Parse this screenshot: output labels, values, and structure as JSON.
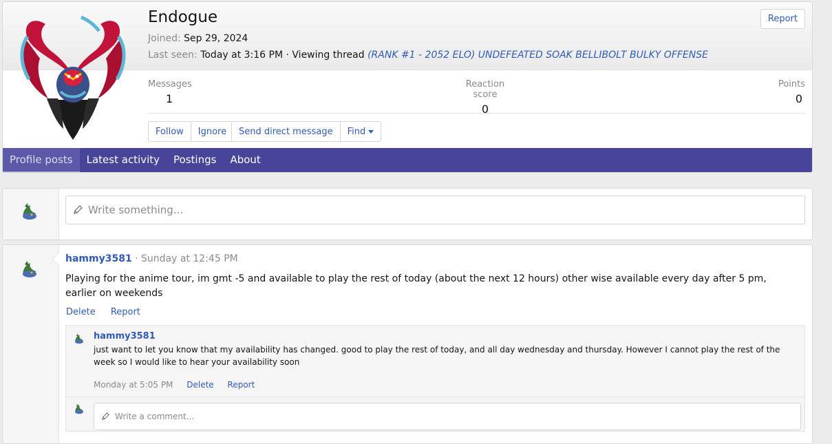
{
  "profile": {
    "username": "Endogue",
    "joined_label": "Joined:",
    "joined_value": "Sep 29, 2024",
    "last_seen_label": "Last seen:",
    "last_seen_value": "Today at 3:16 PM · Viewing thread",
    "thread_link": "(RANK #1 - 2052 ELO) UNDEFEATED SOAK BELLIBOLT BULKY OFFENSE",
    "report_label": "Report",
    "stats": {
      "messages_label": "Messages",
      "messages_value": "1",
      "reaction_label": "Reaction score",
      "reaction_value": "0",
      "points_label": "Points",
      "points_value": "0"
    },
    "buttons": {
      "follow": "Follow",
      "ignore": "Ignore",
      "send_dm": "Send direct message",
      "find": "Find"
    },
    "tabs": [
      "Profile posts",
      "Latest activity",
      "Postings",
      "About"
    ],
    "accent_color": "#47449a"
  },
  "compose": {
    "placeholder": "Write something..."
  },
  "post": {
    "author": "hammy3581",
    "time": "· Sunday at 12:45 PM",
    "body": "Playing for the anime tour, im gmt -5 and available to play the rest of today (about the next 12 hours) other wise available every day after 5 pm, earlier on weekends",
    "delete_label": "Delete",
    "report_label": "Report",
    "comment": {
      "author": "hammy3581",
      "body": "just want to let you know that my availability has changed. good to play the rest of today, and all day wednesday and thursday. However I cannot play the rest of the week so I would like to hear your availability soon",
      "time": "Monday at 5:05 PM",
      "delete_label": "Delete",
      "report_label": "Report"
    },
    "reply_placeholder": "Write a comment..."
  }
}
